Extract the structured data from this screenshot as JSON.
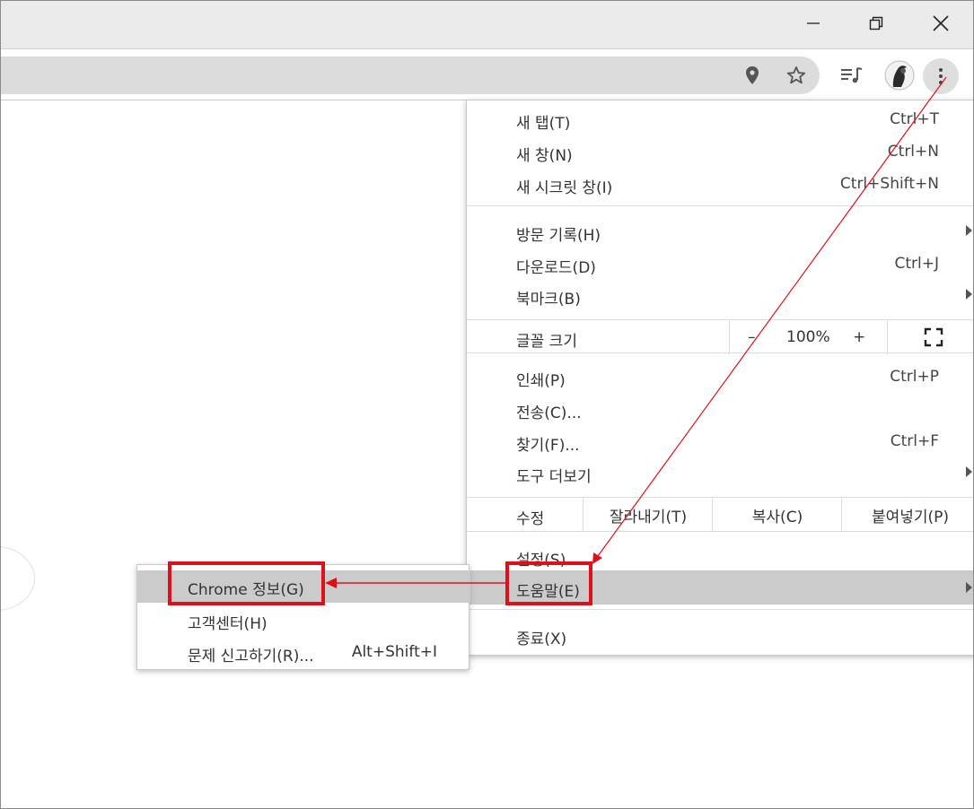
{
  "window": {
    "minimize_icon": "minimize-icon",
    "restore_icon": "restore-icon",
    "close_icon": "close-icon"
  },
  "toolbar": {
    "location_icon": "location-pin-icon",
    "star_icon": "bookmark-star-icon",
    "media_icon": "media-queue-icon",
    "menu_icon": "three-dot-menu-icon"
  },
  "main_menu": {
    "new_tab": {
      "label": "새 탭(T)",
      "shortcut": "Ctrl+T"
    },
    "new_window": {
      "label": "새 창(N)",
      "shortcut": "Ctrl+N"
    },
    "incognito": {
      "label": "새 시크릿 창(I)",
      "shortcut": "Ctrl+Shift+N"
    },
    "history": {
      "label": "방문 기록(H)"
    },
    "downloads": {
      "label": "다운로드(D)",
      "shortcut": "Ctrl+J"
    },
    "bookmarks": {
      "label": "북마크(B)"
    },
    "zoom": {
      "label": "글꼴 크기",
      "minus": "–",
      "value": "100%",
      "plus": "+"
    },
    "print": {
      "label": "인쇄(P)",
      "shortcut": "Ctrl+P"
    },
    "cast": {
      "label": "전송(C)..."
    },
    "find": {
      "label": "찾기(F)...",
      "shortcut": "Ctrl+F"
    },
    "more_tools": {
      "label": "도구 더보기"
    },
    "edit": {
      "label": "수정",
      "cut": "잘라내기(T)",
      "copy": "복사(C)",
      "paste": "붙여넣기(P)"
    },
    "settings": {
      "label": "설정(S)"
    },
    "help": {
      "label": "도움말(E)"
    },
    "exit": {
      "label": "종료(X)"
    }
  },
  "help_submenu": {
    "about": {
      "label": "Chrome 정보(G)"
    },
    "help_center": {
      "label": "고객센터(H)"
    },
    "report_issue": {
      "label": "문제 신고하기(R)...",
      "shortcut": "Alt+Shift+I"
    }
  },
  "colors": {
    "annotation_red": "#e0101a",
    "highlight": "#cbcbcb"
  }
}
